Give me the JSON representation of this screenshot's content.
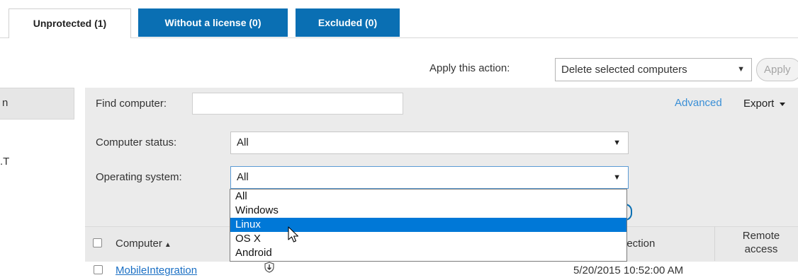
{
  "tabs": [
    {
      "label": "Unprotected (1)"
    },
    {
      "label": "Without a license (0)"
    },
    {
      "label": "Excluded (0)"
    }
  ],
  "action_bar": {
    "label": "Apply this action:",
    "selected": "Delete selected computers",
    "apply_label": "Apply"
  },
  "left_panel": {
    "partial_text": "n",
    "partial_text_2": ".T"
  },
  "filters": {
    "find_label": "Find computer:",
    "find_value": "",
    "advanced_label": "Advanced",
    "export_label": "Export",
    "status_label": "Computer status:",
    "status_value": "All",
    "os_label": "Operating system:",
    "os_value": "All",
    "os_options": [
      "All",
      "Windows",
      "Linux",
      "OS X",
      "Android"
    ],
    "os_highlighted": "Linux"
  },
  "table": {
    "col_computer": "Computer",
    "col_connection": "nection",
    "col_remote": "Remote access",
    "rows": [
      {
        "computer": "MobileIntegration",
        "last_connection": "5/20/2015 10:52:00 AM"
      }
    ]
  },
  "colors": {
    "tab_blue": "#0a6fb3",
    "link": "#1a6fc4",
    "dropdown_highlight": "#0078d7",
    "panel_bg": "#ebebeb"
  },
  "icons": [
    "chevron-down-icon",
    "sort-ascending-icon",
    "shield-icon",
    "mouse-pointer-icon"
  ]
}
